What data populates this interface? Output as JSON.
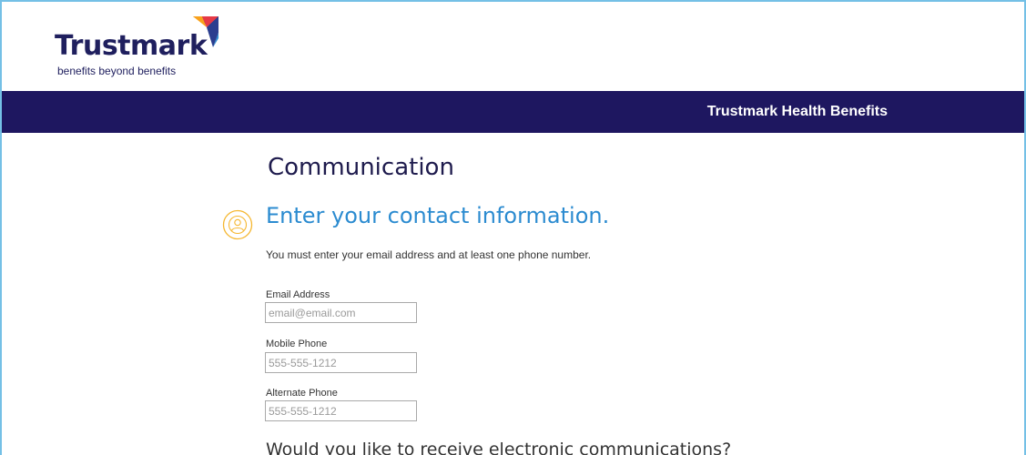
{
  "header": {
    "logo_name": "Trustmark",
    "logo_tagline": "benefits beyond benefits",
    "logo_mark_colors": [
      "#f9a11b",
      "#e63946",
      "#2b3e8f",
      "#2b8bd0"
    ]
  },
  "navbar": {
    "title": "Trustmark Health Benefits",
    "background_color": "#1e1760"
  },
  "main": {
    "page_title": "Communication",
    "section_icon": "user-circle-icon",
    "section_heading": "Enter your contact information.",
    "instructions": "You must enter your email address and at least one phone number.",
    "fields": [
      {
        "label": "Email Address",
        "value": "",
        "placeholder": "email@email.com"
      },
      {
        "label": "Mobile Phone",
        "value": "",
        "placeholder": "555-555-1212"
      },
      {
        "label": "Alternate Phone",
        "value": "",
        "placeholder": "555-555-1212"
      }
    ],
    "question": "Would you like to receive electronic communications?"
  },
  "colors": {
    "accent": "#2b8bd0",
    "icon": "#f5b731",
    "frame_border": "#74c0e6"
  }
}
